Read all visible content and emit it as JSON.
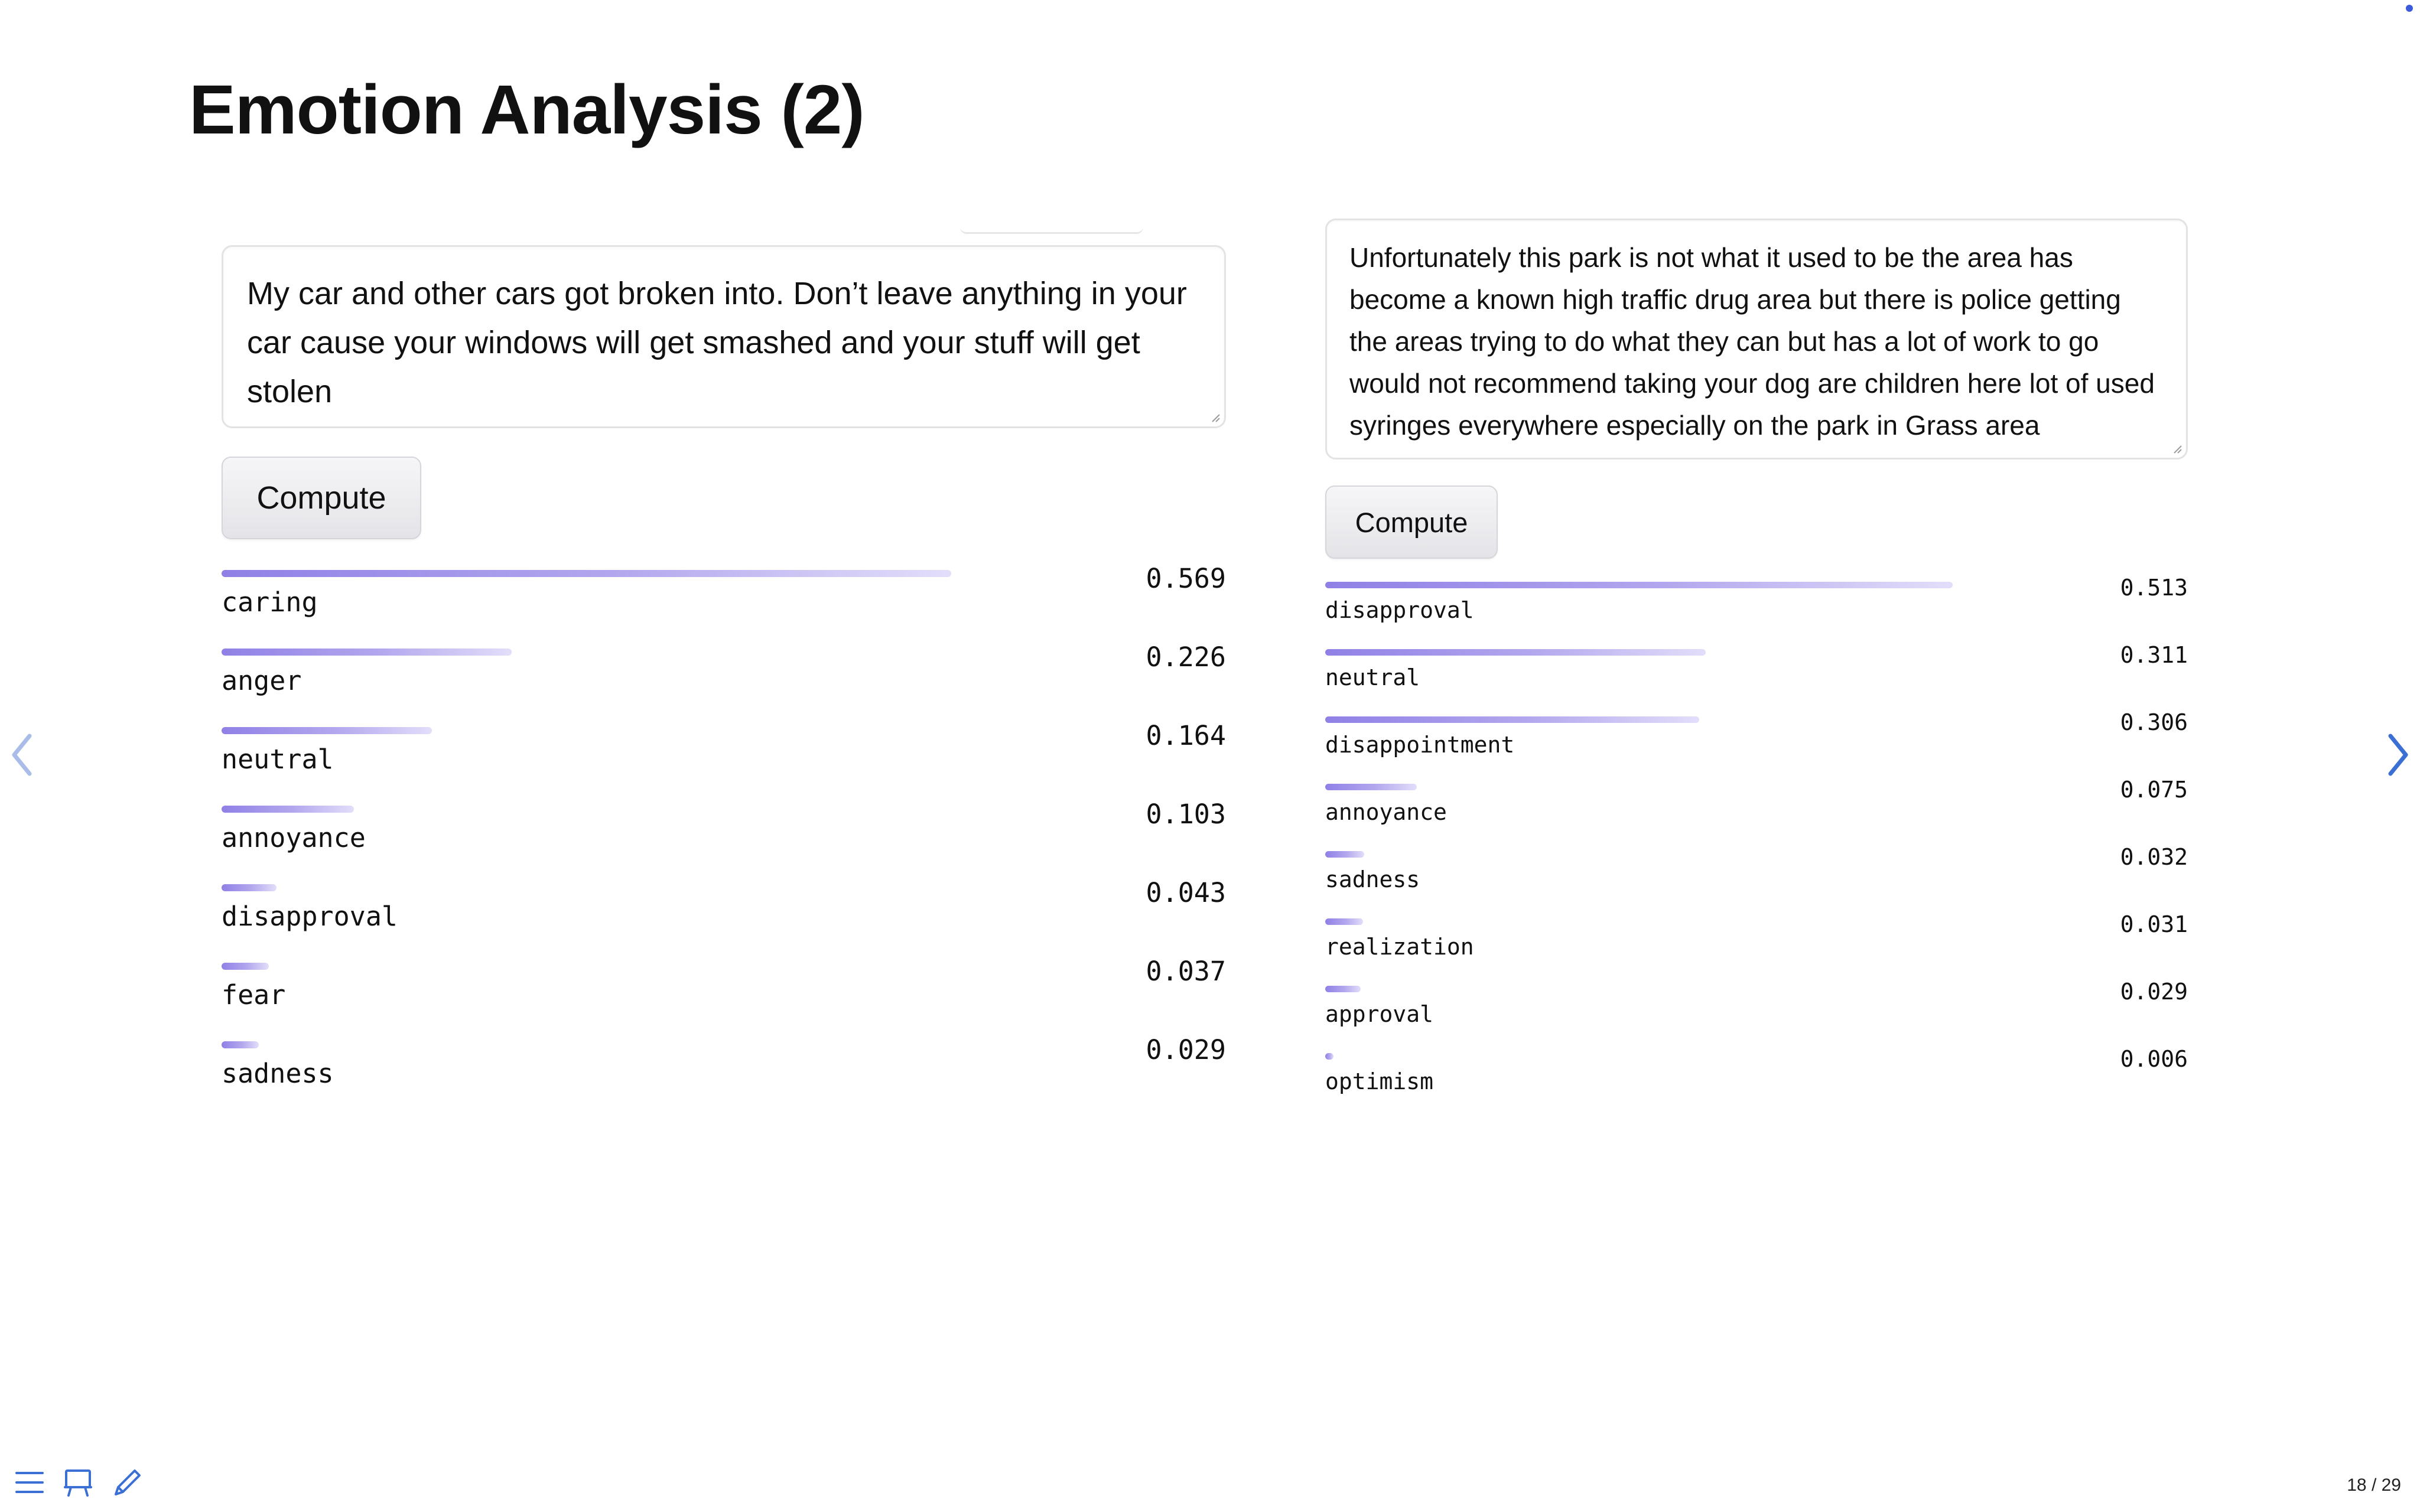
{
  "slide": {
    "title": "Emotion Analysis (2)",
    "page_indicator": "18 / 29"
  },
  "left_widget": {
    "input_text": "My car and other cars got broken into. Don’t leave anything in your car cause your windows will get smashed and your stuff will get stolen",
    "button_label": "Compute",
    "results": [
      {
        "label": "caring",
        "value_text": "0.569",
        "value": 0.569
      },
      {
        "label": "anger",
        "value_text": "0.226",
        "value": 0.226
      },
      {
        "label": "neutral",
        "value_text": "0.164",
        "value": 0.164
      },
      {
        "label": "annoyance",
        "value_text": "0.103",
        "value": 0.103
      },
      {
        "label": "disapproval",
        "value_text": "0.043",
        "value": 0.043
      },
      {
        "label": "fear",
        "value_text": "0.037",
        "value": 0.037
      },
      {
        "label": "sadness",
        "value_text": "0.029",
        "value": 0.029
      }
    ]
  },
  "right_widget": {
    "input_text": "Unfortunately this park is not what it used to be the area has become a known high traffic drug area but there is police getting the areas trying to do what they can but has a lot of work to go would not recommend taking your dog are children here lot of used syringes everywhere especially on the park in Grass area",
    "button_label": "Compute",
    "results": [
      {
        "label": "disapproval",
        "value_text": "0.513",
        "value": 0.513
      },
      {
        "label": "neutral",
        "value_text": "0.311",
        "value": 0.311
      },
      {
        "label": "disappointment",
        "value_text": "0.306",
        "value": 0.306
      },
      {
        "label": "annoyance",
        "value_text": "0.075",
        "value": 0.075
      },
      {
        "label": "sadness",
        "value_text": "0.032",
        "value": 0.032
      },
      {
        "label": "realization",
        "value_text": "0.031",
        "value": 0.031
      },
      {
        "label": "approval",
        "value_text": "0.029",
        "value": 0.029
      },
      {
        "label": "optimism",
        "value_text": "0.006",
        "value": 0.006
      }
    ]
  },
  "icons": {
    "prev": "chevron-left-icon",
    "next": "chevron-right-icon",
    "menu": "menu-icon",
    "overview": "presentation-board-icon",
    "draw": "pencil-icon"
  },
  "colors": {
    "bar_start": "#8f80e6",
    "bar_end": "#e2defa",
    "nav_arrow": "#3b6fd4"
  }
}
